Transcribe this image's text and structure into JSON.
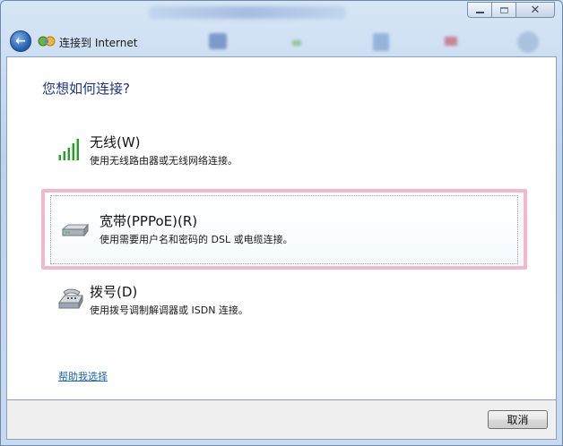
{
  "window": {
    "minimize_icon": "minimize-icon",
    "maximize_icon": "maximize-icon",
    "close_glyph": "✕"
  },
  "nav": {
    "back_glyph": "←",
    "title": "连接到 Internet"
  },
  "main": {
    "heading": "您想如何连接?",
    "options": [
      {
        "icon": "wireless-signal-icon",
        "title": "无线(W)",
        "description": "使用无线路由器或无线网络连接。",
        "selected": false
      },
      {
        "icon": "broadband-modem-icon",
        "title": "宽带(PPPoE)(R)",
        "description": "使用需要用户名和密码的 DSL 或电缆连接。",
        "selected": true
      },
      {
        "icon": "dialup-phone-icon",
        "title": "拨号(D)",
        "description": "使用拨号调制解调器或 ISDN 连接。",
        "selected": false
      }
    ],
    "help_link": "帮助我选择"
  },
  "footer": {
    "cancel_label": "取消"
  },
  "colors": {
    "heading": "#1e3287",
    "link": "#1a64b4",
    "selection_highlight": "#f2b7cf"
  }
}
